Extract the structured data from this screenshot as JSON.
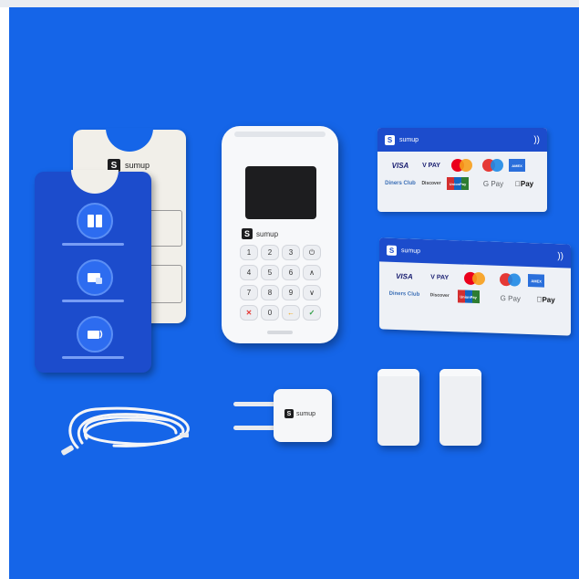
{
  "brand": {
    "wordmark": "sumup",
    "logo_letter": "S"
  },
  "terminal": {
    "keys": [
      "1",
      "2",
      "3",
      "⏻",
      "4",
      "5",
      "6",
      "∧",
      "7",
      "8",
      "9",
      "∨",
      "✕",
      "0",
      "←",
      "✓"
    ]
  },
  "payment_logos": [
    "VISA",
    "V PAY",
    "mastercard",
    "maestro",
    "AMEX",
    "Diners Club",
    "Discover",
    "UnionPay",
    "G Pay",
    "Pay"
  ],
  "colors": {
    "background": "#1565e8",
    "guide_blue": "#1c4ccc",
    "device_white": "#f7f8fa"
  },
  "icons": {
    "contactless": "contactless-icon",
    "guide_icons": [
      "keypad-icon",
      "card-lock-icon",
      "card-tap-icon"
    ]
  }
}
